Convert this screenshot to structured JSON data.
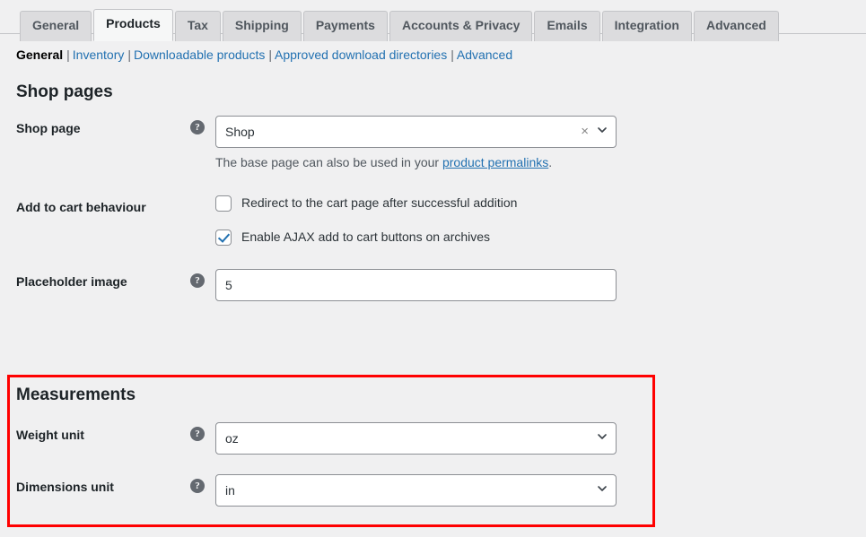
{
  "tabs": [
    {
      "label": "General",
      "active": false
    },
    {
      "label": "Products",
      "active": true
    },
    {
      "label": "Tax",
      "active": false
    },
    {
      "label": "Shipping",
      "active": false
    },
    {
      "label": "Payments",
      "active": false
    },
    {
      "label": "Accounts & Privacy",
      "active": false
    },
    {
      "label": "Emails",
      "active": false
    },
    {
      "label": "Integration",
      "active": false
    },
    {
      "label": "Advanced",
      "active": false
    }
  ],
  "subnav": {
    "current": "General",
    "links": [
      "Inventory",
      "Downloadable products",
      "Approved download directories",
      "Advanced"
    ],
    "separator": "|"
  },
  "shop_pages": {
    "heading": "Shop pages",
    "shop_page": {
      "label": "Shop page",
      "help": "?",
      "value": "Shop",
      "clear_icon": "×",
      "desc_prefix": "The base page can also be used in your ",
      "desc_link": "product permalinks",
      "desc_suffix": "."
    },
    "add_to_cart": {
      "label": "Add to cart behaviour",
      "options": [
        {
          "label": "Redirect to the cart page after successful addition",
          "checked": false
        },
        {
          "label": "Enable AJAX add to cart buttons on archives",
          "checked": true
        }
      ]
    },
    "placeholder_image": {
      "label": "Placeholder image",
      "help": "?",
      "value": "5"
    }
  },
  "measurements": {
    "heading": "Measurements",
    "weight_unit": {
      "label": "Weight unit",
      "help": "?",
      "value": "oz"
    },
    "dimensions_unit": {
      "label": "Dimensions unit",
      "help": "?",
      "value": "in"
    }
  },
  "colors": {
    "highlight": "#ff0000",
    "link": "#2271b1",
    "background": "#f0f0f1"
  }
}
